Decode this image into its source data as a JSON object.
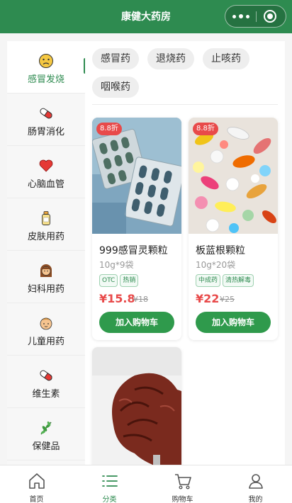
{
  "app": {
    "title": "康健大药房"
  },
  "sidebar": {
    "items": [
      {
        "label": "感冒发烧",
        "icon": "sick-face-icon",
        "active": true
      },
      {
        "label": "肠胃消化",
        "icon": "capsule-pill-icon",
        "active": false
      },
      {
        "label": "心脑血管",
        "icon": "heart-icon",
        "active": false
      },
      {
        "label": "皮肤用药",
        "icon": "lotion-bottle-icon",
        "active": false
      },
      {
        "label": "妇科用药",
        "icon": "woman-icon",
        "active": false
      },
      {
        "label": "儿童用药",
        "icon": "baby-icon",
        "active": false
      },
      {
        "label": "维生素",
        "icon": "capsule-pill-icon",
        "active": false
      },
      {
        "label": "保健品",
        "icon": "herb-leaf-icon",
        "active": false
      }
    ]
  },
  "subcategories": [
    "感冒药",
    "退烧药",
    "止咳药",
    "咽喉药"
  ],
  "products": [
    {
      "discount": "8.8折",
      "name": "999感冒灵颗粒",
      "spec": "10g*9袋",
      "badges": [
        "OTC",
        "热销"
      ],
      "price": "¥15.8",
      "old_price": "¥18",
      "cart_label": "加入购物车",
      "image": "blister-packs-photo"
    },
    {
      "discount": "8.8折",
      "name": "板蓝根颗粒",
      "spec": "10g*20袋",
      "badges": [
        "中成药",
        "清热解毒"
      ],
      "price": "¥22",
      "old_price": "¥25",
      "cart_label": "加入购物车",
      "image": "colorful-pills-photo"
    },
    {
      "image": "brain-model-photo"
    }
  ],
  "tabbar": {
    "items": [
      {
        "label": "首页",
        "icon": "home-icon",
        "active": false
      },
      {
        "label": "分类",
        "icon": "list-icon",
        "active": true
      },
      {
        "label": "购物车",
        "icon": "cart-icon",
        "active": false
      },
      {
        "label": "我的",
        "icon": "user-icon",
        "active": false
      }
    ]
  },
  "colors": {
    "brand": "#2e8b50",
    "price": "#e84a4a",
    "button": "#2f9a4c"
  }
}
